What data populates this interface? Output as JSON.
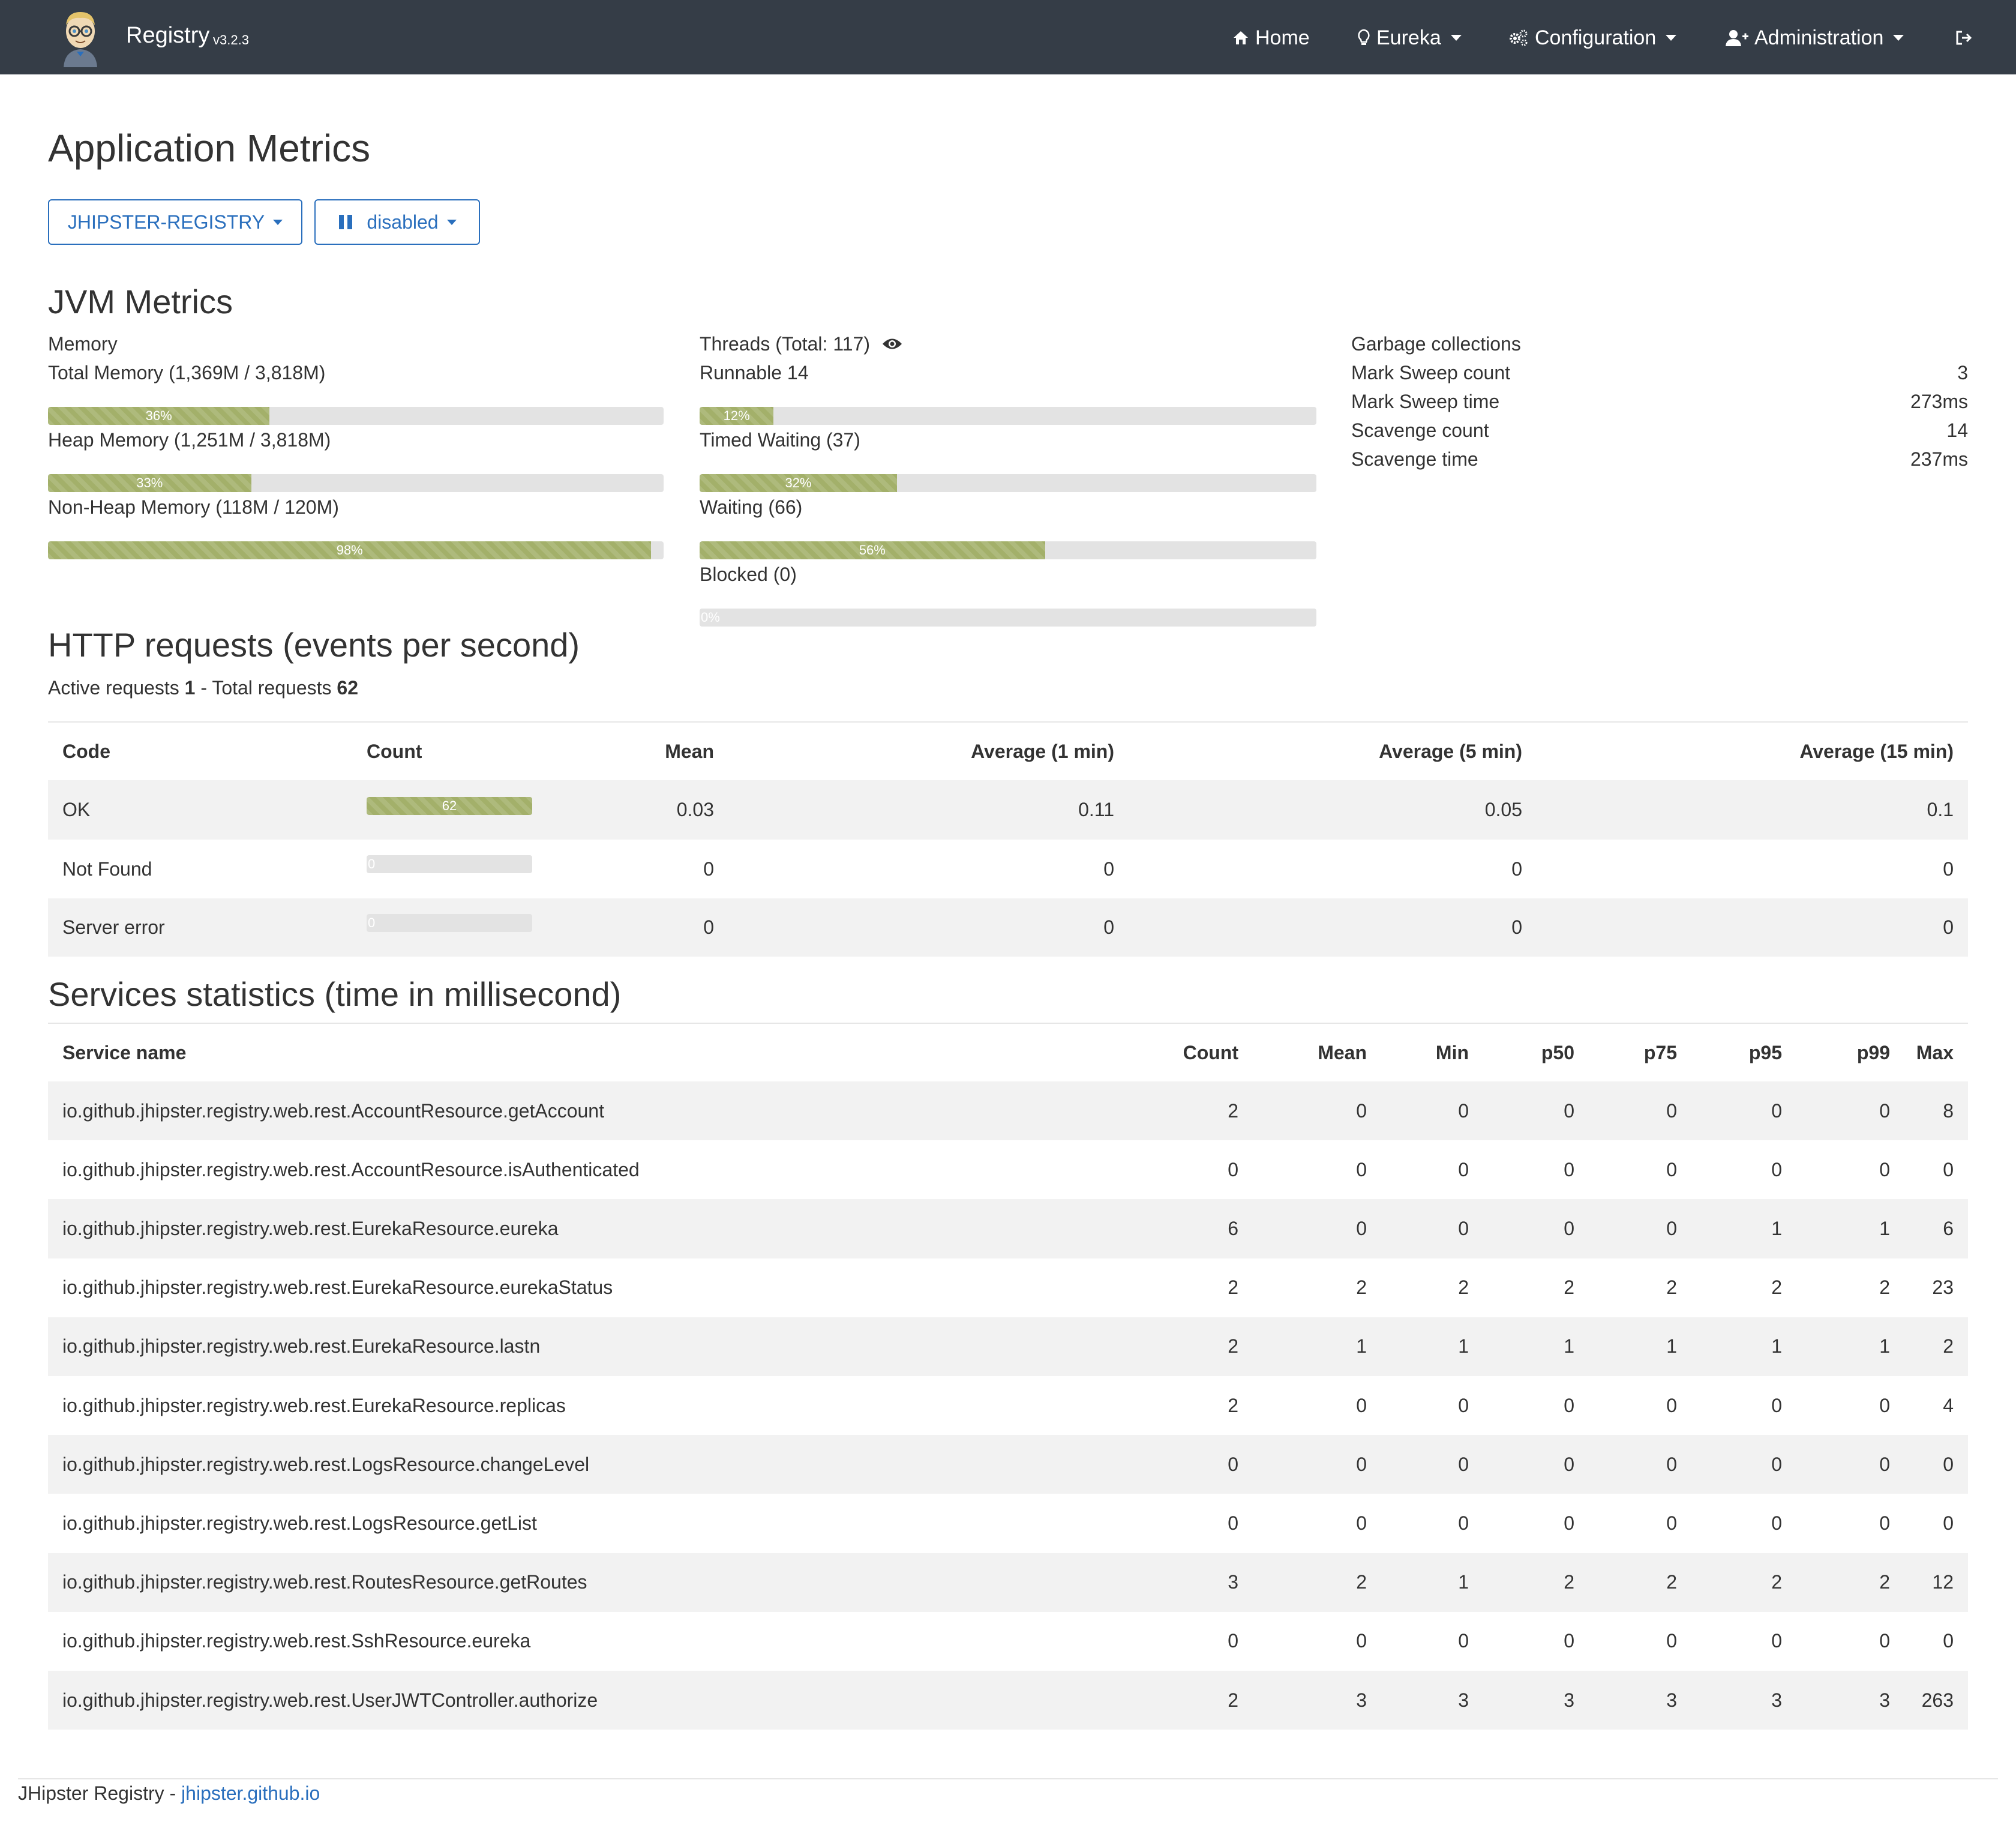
{
  "navbar": {
    "brand": "Registry",
    "version": "v3.2.3",
    "items": [
      {
        "label": "Home",
        "icon": "home-icon"
      },
      {
        "label": "Eureka",
        "icon": "eureka-icon"
      },
      {
        "label": "Configuration",
        "icon": "gears-icon"
      },
      {
        "label": "Administration",
        "icon": "user-plus-icon"
      }
    ],
    "logout_icon": "sign-out-icon"
  },
  "page": {
    "title": "Application Metrics",
    "app_selector": "JHIPSTER-REGISTRY",
    "refresh_selector": "disabled"
  },
  "jvm": {
    "title": "JVM Metrics",
    "memory": {
      "heading": "Memory",
      "rows": [
        {
          "label": "Total Memory (1,369M / 3,818M)",
          "percent": 36,
          "percent_label": "36%"
        },
        {
          "label": "Heap Memory (1,251M / 3,818M)",
          "percent": 33,
          "percent_label": "33%"
        },
        {
          "label": "Non-Heap Memory (118M / 120M)",
          "percent": 98,
          "percent_label": "98%"
        }
      ]
    },
    "threads": {
      "heading": "Threads",
      "total": "(Total: 117)",
      "rows": [
        {
          "label": "Runnable 14",
          "percent": 12,
          "percent_label": "12%"
        },
        {
          "label": "Timed Waiting (37)",
          "percent": 32,
          "percent_label": "32%"
        },
        {
          "label": "Waiting (66)",
          "percent": 56,
          "percent_label": "56%"
        },
        {
          "label": "Blocked (0)",
          "percent": 0,
          "percent_label": "0%"
        }
      ]
    },
    "gc": {
      "heading": "Garbage collections",
      "rows": [
        {
          "label": "Mark Sweep count",
          "value": "3"
        },
        {
          "label": "Mark Sweep time",
          "value": "273ms"
        },
        {
          "label": "Scavenge count",
          "value": "14"
        },
        {
          "label": "Scavenge time",
          "value": "237ms"
        }
      ]
    }
  },
  "http": {
    "title": "HTTP requests (events per second)",
    "active_label": "Active requests",
    "active": "1",
    "sep": "-",
    "total_label": "Total requests",
    "total": "62",
    "headers": [
      "Code",
      "Count",
      "Mean",
      "Average (1 min)",
      "Average (5 min)",
      "Average (15 min)"
    ],
    "rows": [
      {
        "code": "OK",
        "count": "62",
        "count_pct": 100,
        "mean": "0.03",
        "avg1": "0.11",
        "avg5": "0.05",
        "avg15": "0.1"
      },
      {
        "code": "Not Found",
        "count": "0",
        "count_pct": 0,
        "mean": "0",
        "avg1": "0",
        "avg5": "0",
        "avg15": "0"
      },
      {
        "code": "Server error",
        "count": "0",
        "count_pct": 0,
        "mean": "0",
        "avg1": "0",
        "avg5": "0",
        "avg15": "0"
      }
    ]
  },
  "services": {
    "title": "Services statistics (time in millisecond)",
    "headers": [
      "Service name",
      "Count",
      "Mean",
      "Min",
      "p50",
      "p75",
      "p95",
      "p99",
      "Max"
    ],
    "rows": [
      [
        "io.github.jhipster.registry.web.rest.AccountResource.getAccount",
        "2",
        "0",
        "0",
        "0",
        "0",
        "0",
        "0",
        "8"
      ],
      [
        "io.github.jhipster.registry.web.rest.AccountResource.isAuthenticated",
        "0",
        "0",
        "0",
        "0",
        "0",
        "0",
        "0",
        "0"
      ],
      [
        "io.github.jhipster.registry.web.rest.EurekaResource.eureka",
        "6",
        "0",
        "0",
        "0",
        "0",
        "1",
        "1",
        "6"
      ],
      [
        "io.github.jhipster.registry.web.rest.EurekaResource.eurekaStatus",
        "2",
        "2",
        "2",
        "2",
        "2",
        "2",
        "2",
        "23"
      ],
      [
        "io.github.jhipster.registry.web.rest.EurekaResource.lastn",
        "2",
        "1",
        "1",
        "1",
        "1",
        "1",
        "1",
        "2"
      ],
      [
        "io.github.jhipster.registry.web.rest.EurekaResource.replicas",
        "2",
        "0",
        "0",
        "0",
        "0",
        "0",
        "0",
        "4"
      ],
      [
        "io.github.jhipster.registry.web.rest.LogsResource.changeLevel",
        "0",
        "0",
        "0",
        "0",
        "0",
        "0",
        "0",
        "0"
      ],
      [
        "io.github.jhipster.registry.web.rest.LogsResource.getList",
        "0",
        "0",
        "0",
        "0",
        "0",
        "0",
        "0",
        "0"
      ],
      [
        "io.github.jhipster.registry.web.rest.RoutesResource.getRoutes",
        "3",
        "2",
        "1",
        "2",
        "2",
        "2",
        "2",
        "12"
      ],
      [
        "io.github.jhipster.registry.web.rest.SshResource.eureka",
        "0",
        "0",
        "0",
        "0",
        "0",
        "0",
        "0",
        "0"
      ],
      [
        "io.github.jhipster.registry.web.rest.UserJWTController.authorize",
        "2",
        "3",
        "3",
        "3",
        "3",
        "3",
        "3",
        "263"
      ]
    ]
  },
  "footer": {
    "text": "JHipster Registry -",
    "link": "jhipster.github.io"
  },
  "colors": {
    "navbar": "#353d47",
    "bar": "#a3b06a",
    "track": "#e3e3e3",
    "link": "#2a6fbd",
    "stripe": "#f2f2f2"
  }
}
